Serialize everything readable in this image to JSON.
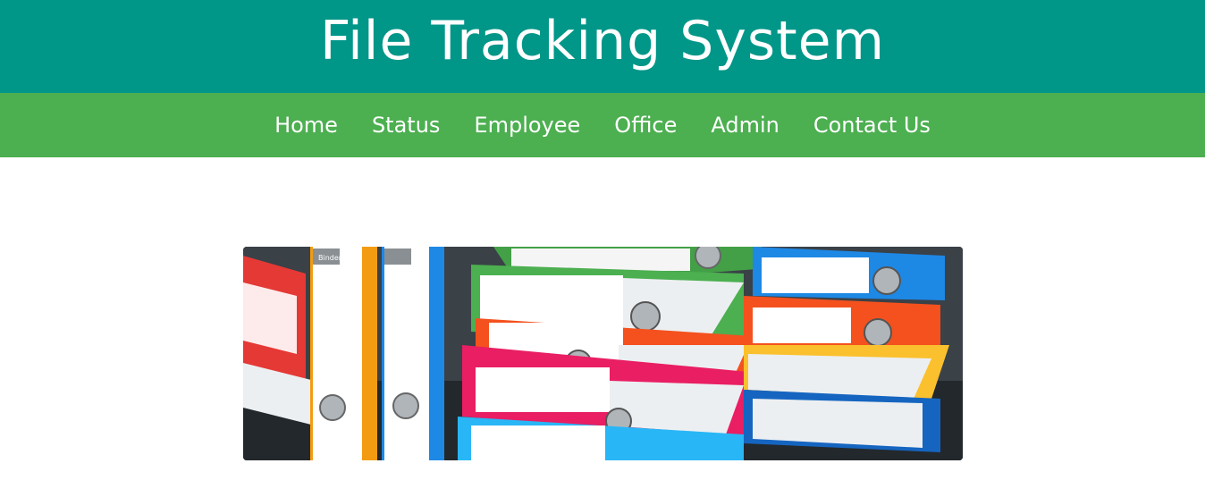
{
  "header": {
    "title": "File Tracking System",
    "background_color": "#009688"
  },
  "nav": {
    "background_color": "#4caf50",
    "items": [
      {
        "label": "Home"
      },
      {
        "label": "Status"
      },
      {
        "label": "Employee"
      },
      {
        "label": "Office"
      },
      {
        "label": "Admin"
      },
      {
        "label": "Contact Us"
      }
    ]
  },
  "banner": {
    "spine_label": "Binder"
  }
}
